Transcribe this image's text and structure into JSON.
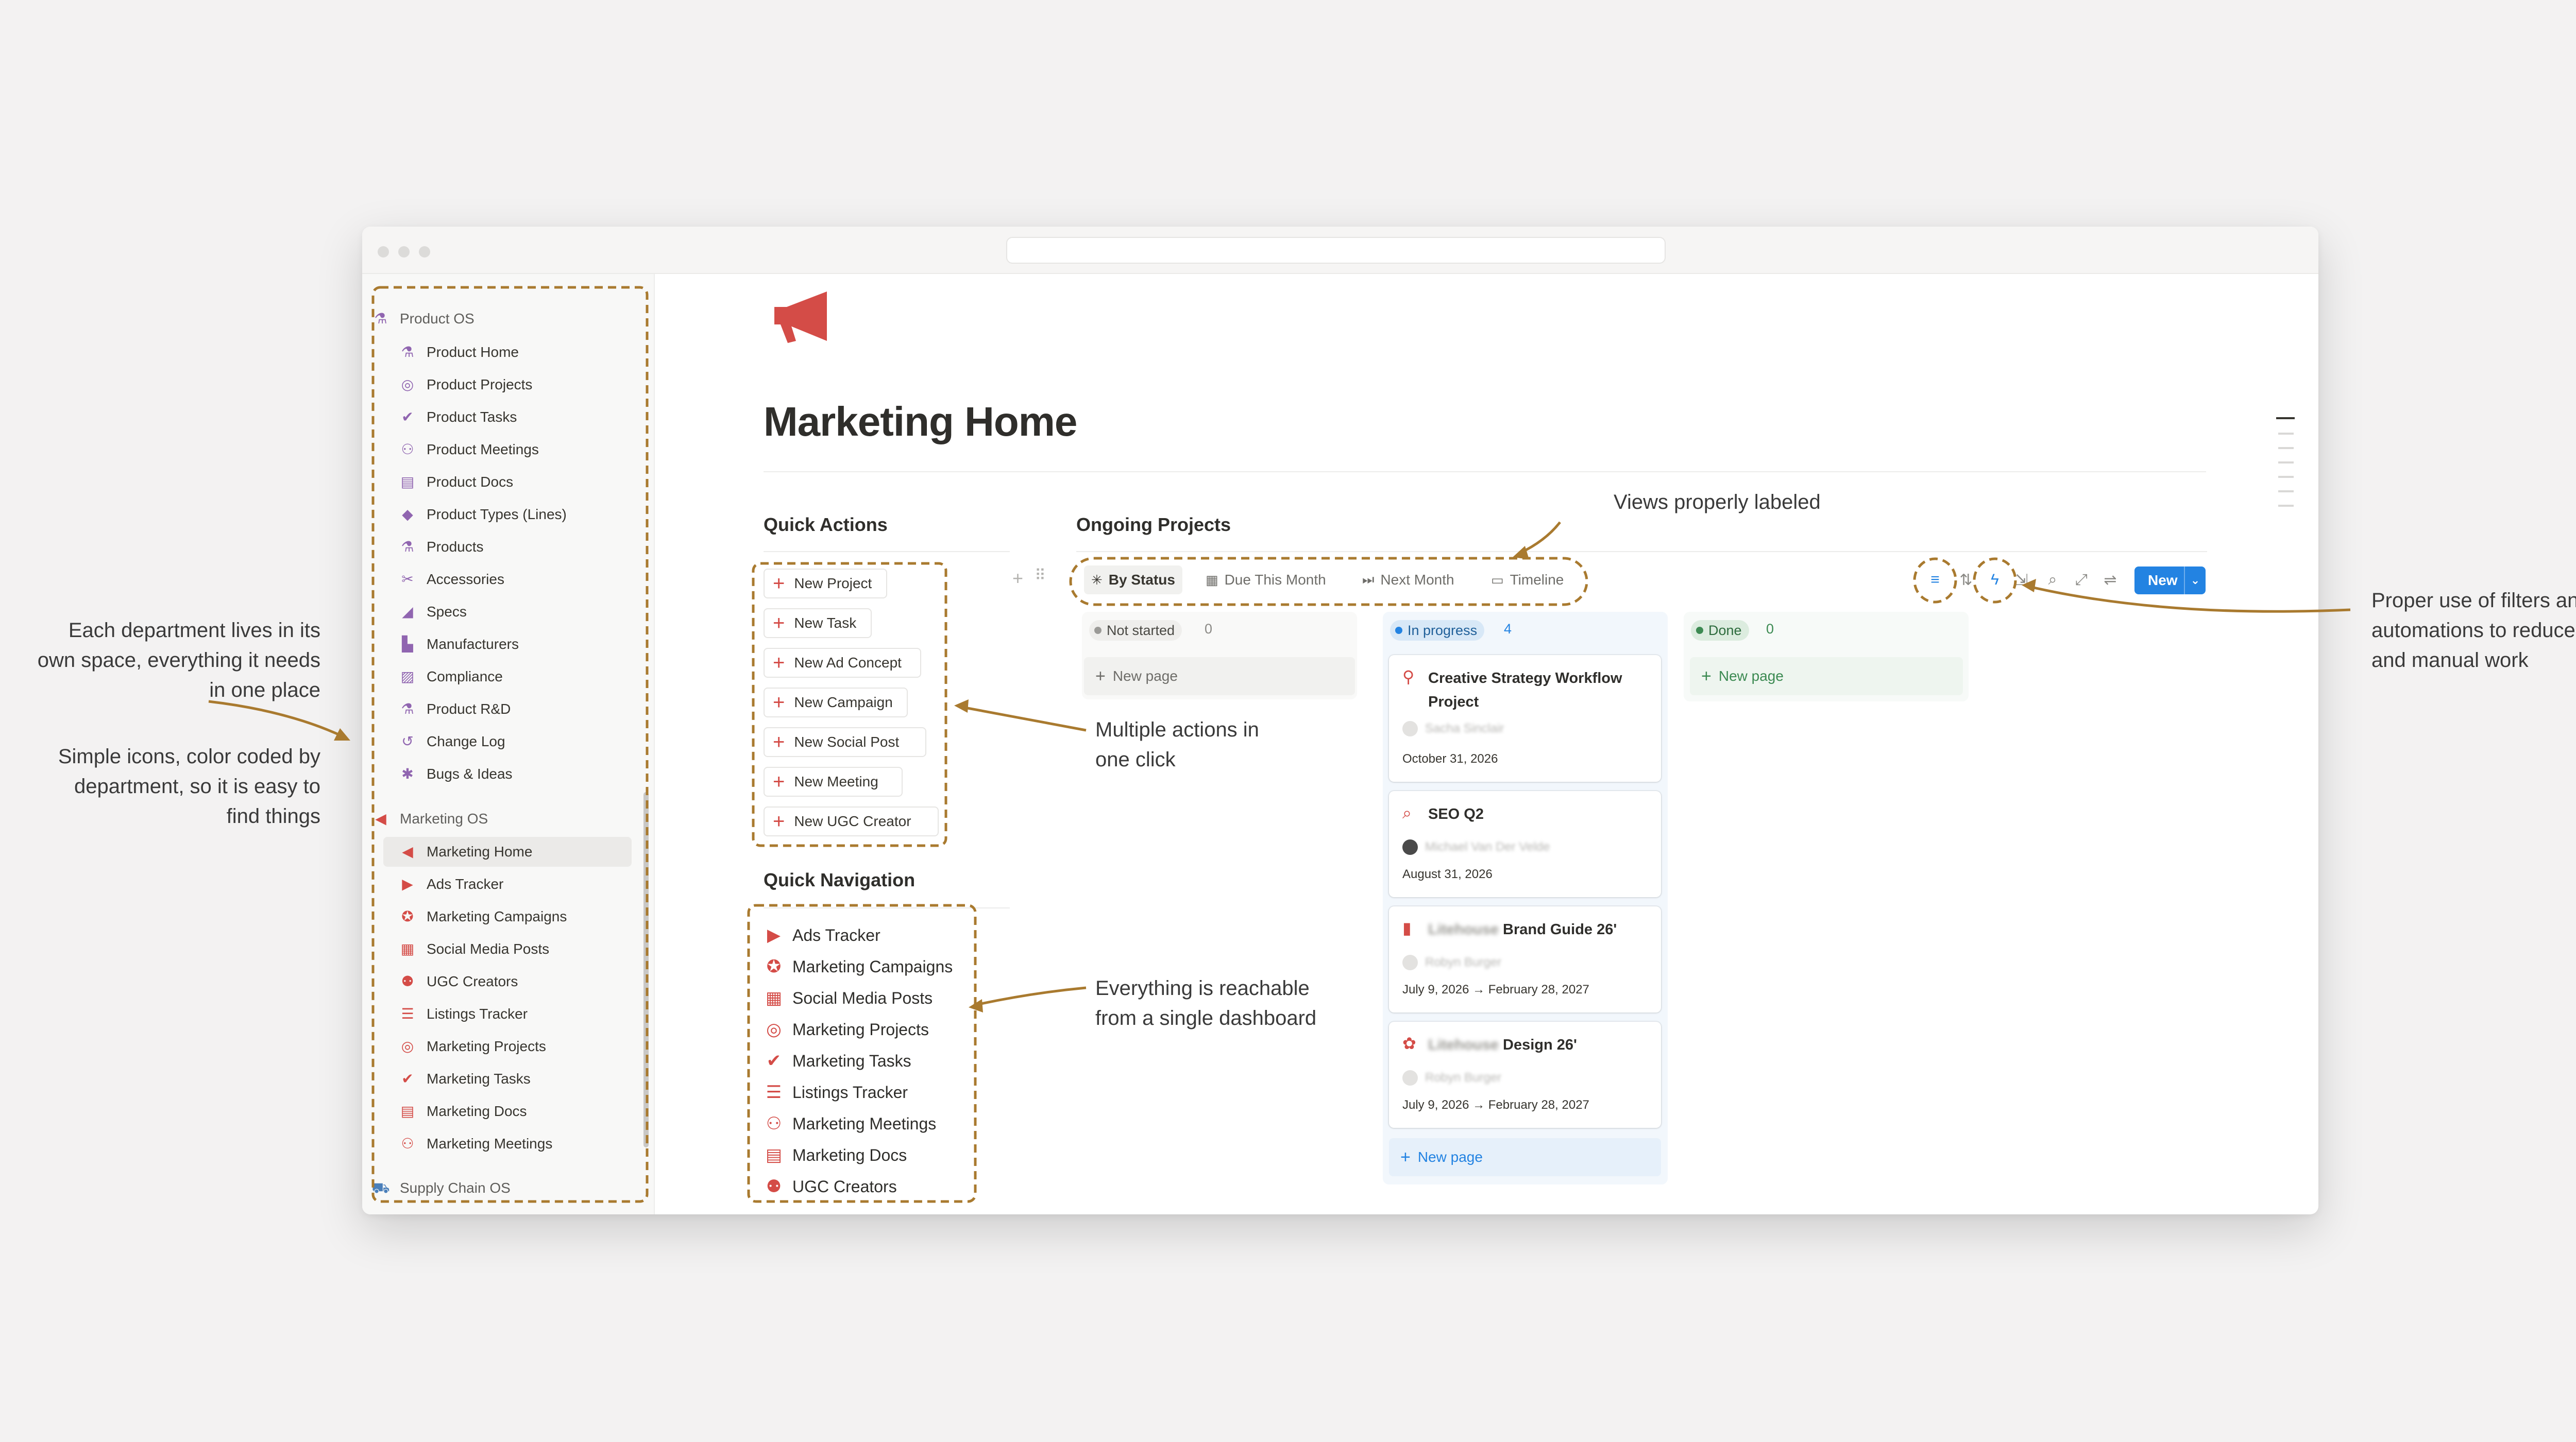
{
  "sidebar": {
    "product_section": "Product OS",
    "product_items": [
      {
        "label": "Product Home",
        "icon": "flask-icon"
      },
      {
        "label": "Product Projects",
        "icon": "target-icon"
      },
      {
        "label": "Product Tasks",
        "icon": "check-circle-icon"
      },
      {
        "label": "Product Meetings",
        "icon": "people-icon"
      },
      {
        "label": "Product Docs",
        "icon": "docs-icon"
      },
      {
        "label": "Product Types (Lines)",
        "icon": "shapes-icon"
      },
      {
        "label": "Products",
        "icon": "flask-icon"
      },
      {
        "label": "Accessories",
        "icon": "scissors-icon"
      },
      {
        "label": "Specs",
        "icon": "ruler-icon"
      },
      {
        "label": "Manufacturers",
        "icon": "factory-icon"
      },
      {
        "label": "Compliance",
        "icon": "scroll-icon"
      },
      {
        "label": "Product R&D",
        "icon": "beaker-icon"
      },
      {
        "label": "Change Log",
        "icon": "history-icon"
      },
      {
        "label": "Bugs & Ideas",
        "icon": "bug-icon"
      }
    ],
    "marketing_section": "Marketing OS",
    "marketing_items": [
      {
        "label": "Marketing Home",
        "icon": "megaphone-icon"
      },
      {
        "label": "Ads Tracker",
        "icon": "play-circle-icon"
      },
      {
        "label": "Marketing Campaigns",
        "icon": "campaign-icon"
      },
      {
        "label": "Social Media Posts",
        "icon": "social-icon"
      },
      {
        "label": "UGC Creators",
        "icon": "creator-icon"
      },
      {
        "label": "Listings Tracker",
        "icon": "list-icon"
      },
      {
        "label": "Marketing Projects",
        "icon": "target-icon"
      },
      {
        "label": "Marketing Tasks",
        "icon": "check-circle-icon"
      },
      {
        "label": "Marketing Docs",
        "icon": "docs-icon"
      },
      {
        "label": "Marketing Meetings",
        "icon": "people-icon"
      }
    ],
    "supply_section": "Supply Chain OS"
  },
  "page": {
    "title": "Marketing Home",
    "icon": "megaphone-icon"
  },
  "quick_actions": {
    "heading": "Quick Actions",
    "items": [
      "New Project",
      "New Task",
      "New Ad Concept",
      "New Campaign",
      "New Social Post",
      "New Meeting",
      "New UGC Creator"
    ]
  },
  "quick_navigation": {
    "heading": "Quick Navigation",
    "items": [
      "Ads Tracker",
      "Marketing Campaigns",
      "Social Media Posts",
      "Marketing Projects",
      "Marketing Tasks",
      "Listings Tracker",
      "Marketing Meetings",
      "Marketing Docs",
      "UGC Creators"
    ]
  },
  "projects": {
    "heading": "Ongoing Projects",
    "views": [
      "By Status",
      "Due This Month",
      "Next Month",
      "Timeline"
    ],
    "new_button": "New",
    "columns": {
      "not_started": {
        "label": "Not started",
        "count": "0"
      },
      "in_progress": {
        "label": "In progress",
        "count": "4"
      },
      "done": {
        "label": "Done",
        "count": "0"
      }
    },
    "new_page": "New page",
    "cards": [
      {
        "title": "Creative Strategy Workflow Project",
        "person": "Sacha Sinclair",
        "date": "October 31, 2026"
      },
      {
        "title": "SEO Q2",
        "person": "Michael Van Der Velde",
        "date": "August 31, 2026"
      },
      {
        "title_blur": "Litehouse",
        "title": "Brand Guide 26'",
        "person": "Robyn Burger",
        "date": "July 9, 2026 → February 28, 2027"
      },
      {
        "title_blur": "Litehouse",
        "title": "Design 26'",
        "person": "Robyn Burger",
        "date": "July 9, 2026 → February 28, 2027"
      }
    ]
  },
  "annotations": {
    "department_space": [
      "Each department lives in its",
      "own space, everything it needs",
      "in one place"
    ],
    "simple_icons": [
      "Simple icons, color coded by",
      "department, so it is easy to",
      "find things"
    ],
    "views_labeled": "Views properly labeled",
    "multiple_actions": [
      "Multiple actions in",
      "one click"
    ],
    "reachable": [
      "Everything is reachable",
      "from a single dashboard"
    ],
    "filters": [
      "Proper use of filters and",
      "automations to reduce clutter",
      "and manual work"
    ]
  },
  "colors": {
    "product": "#9065b0",
    "marketing": "#d44c47",
    "supply": "#4a7fba",
    "accent": "#2383e2",
    "annotation": "#a97a2f"
  }
}
